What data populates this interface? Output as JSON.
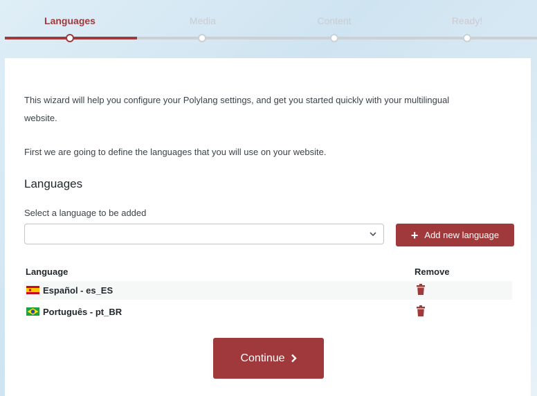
{
  "steps": [
    {
      "label": "Languages",
      "active": true
    },
    {
      "label": "Media",
      "active": false
    },
    {
      "label": "Content",
      "active": false
    },
    {
      "label": "Ready!",
      "active": false
    }
  ],
  "intro": {
    "line1": "This wizard will help you configure your Polylang settings, and get you started quickly with your multilingual",
    "line2": "website.",
    "line3": "First we are going to define the languages that you will use on your website."
  },
  "languages_section": {
    "heading": "Languages",
    "select_label": "Select a language to be added",
    "select_value": "",
    "add_button": "Add new language"
  },
  "table": {
    "col_language": "Language",
    "col_remove": "Remove",
    "rows": [
      {
        "label": "Español - es_ES",
        "flag": "spain-flag-icon"
      },
      {
        "label": "Português - pt_BR",
        "flag": "brazil-flag-icon"
      }
    ]
  },
  "continue_button": "Continue",
  "colors": {
    "accent": "#a0393b",
    "inactive_step": "#c9ccd0",
    "track": "#cdd0d3"
  }
}
